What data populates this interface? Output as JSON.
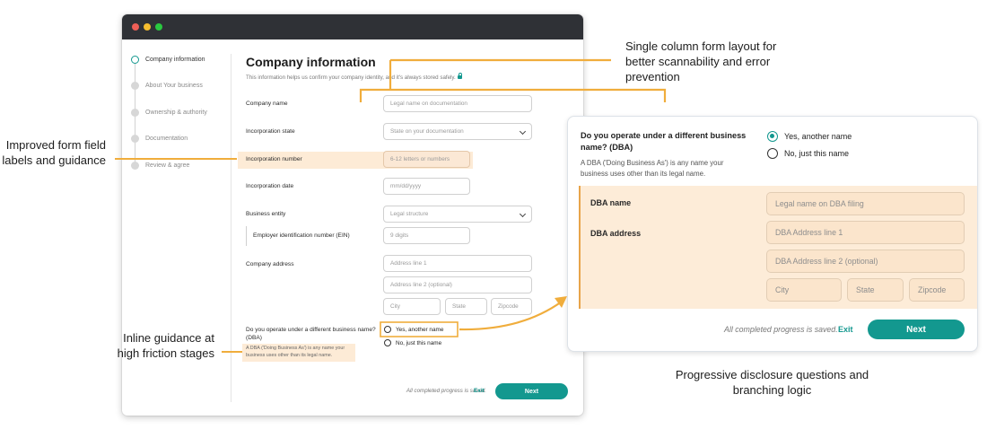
{
  "stepper": {
    "steps": [
      "Company information",
      "About Your business",
      "Ownership & authority",
      "Documentation",
      "Review & agree"
    ],
    "active_index": 0
  },
  "form": {
    "title": "Company information",
    "subtitle": "This information helps us confirm your company identity, and it's always stored safely.",
    "fields": {
      "company_name": {
        "label": "Company name",
        "placeholder": "Legal name on documentation"
      },
      "incorporation_state": {
        "label": "Incorporation state",
        "placeholder": "State on your documentation"
      },
      "incorporation_number": {
        "label": "Incorporation number",
        "placeholder": "6-12 letters or numbers"
      },
      "incorporation_date": {
        "label": "Incorporation date",
        "placeholder": "mm/dd/yyyy"
      },
      "business_entity": {
        "label": "Business entity",
        "placeholder": "Legal structure"
      },
      "ein": {
        "label": "Employer identification number (EIN)",
        "placeholder": "9 digits"
      },
      "company_address": {
        "label": "Company address",
        "line1": "Address line 1",
        "line2": "Address line 2 (optional)",
        "city": "City",
        "state": "State",
        "zip": "Zipcode"
      }
    },
    "dba_question": "Do you operate under a different business name? (DBA)",
    "dba_help": "A DBA ('Doing Business As') is any name your business uses other than its legal name.",
    "dba_options": [
      "Yes, another name",
      "No, just this name"
    ],
    "save_note": "All completed progress is saved.",
    "exit_label": "Exit",
    "next_label": "Next"
  },
  "annotations": {
    "single_column": "Single column form layout for better scannability and error prevention",
    "labels_guidance": "Improved form field labels and guidance",
    "inline_guidance": "Inline guidance at high friction stages",
    "progressive": "Progressive disclosure questions and branching logic"
  },
  "detail_card": {
    "question": "Do you operate under a different business name? (DBA)",
    "help": "A DBA ('Doing Business As') is any name your business uses other than its legal name.",
    "options": [
      "Yes, another name",
      "No, just this name"
    ],
    "selected_option": "Yes, another name",
    "dba_name_label": "DBA name",
    "dba_name_placeholder": "Legal name on DBA filing",
    "dba_address_label": "DBA address",
    "dba_address_line1": "DBA Address line 1",
    "dba_address_line2": "DBA Address line 2 (optional)",
    "city": "City",
    "state": "State",
    "zip": "Zipcode",
    "save_note": "All completed progress is saved.",
    "exit_label": "Exit",
    "next_label": "Next"
  },
  "colors": {
    "accent": "#13988f",
    "highlight": "#fdebd6",
    "annotation_line": "#f0ad3c",
    "titlebar": "#2f3136"
  }
}
